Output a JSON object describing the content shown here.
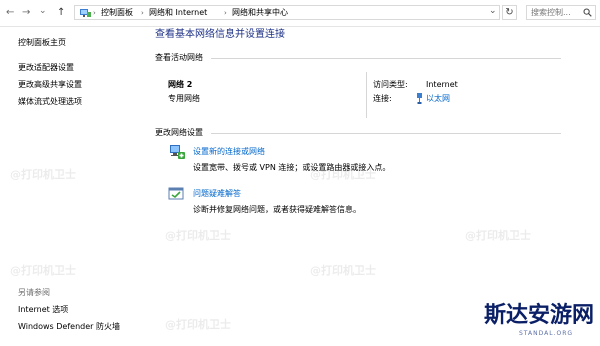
{
  "nav": {
    "back": "←",
    "forward": "→",
    "recent": "⌄",
    "up": "↑"
  },
  "breadcrumb": {
    "items": [
      "控制面板",
      "网络和 Internet",
      "网络和共享中心"
    ],
    "separator": "›",
    "dropdown": "⌄"
  },
  "refresh": "↻",
  "search": {
    "placeholder": "搜索控制..."
  },
  "sidebar": {
    "items": [
      "控制面板主页",
      "更改适配器设置",
      "更改高级共享设置",
      "媒体流式处理选项"
    ],
    "see_also_header": "另请参阅",
    "see_also": [
      "Internet 选项",
      "Windows Defender 防火墙"
    ]
  },
  "main": {
    "title": "查看基本网络信息并设置连接",
    "active_header": "查看活动网络",
    "network": {
      "name": "网络 2",
      "category": "专用网络",
      "access_label": "访问类型:",
      "access_value": "Internet",
      "conn_label": "连接:",
      "conn_value": "以太网"
    },
    "change_header": "更改网络设置",
    "actions": [
      {
        "title": "设置新的连接或网络",
        "desc": "设置宽带、拨号或 VPN 连接；或设置路由器或接入点。"
      },
      {
        "title": "问题疑难解答",
        "desc": "诊断并修复网络问题，或者获得疑难解答信息。"
      }
    ]
  },
  "watermark": "@打印机卫士",
  "brand": {
    "name": "斯达安游网",
    "domain": "STANDAL.ORG"
  },
  "colors": {
    "link": "#0066cc",
    "title": "#1e3287",
    "brand": "#0a1f66"
  }
}
